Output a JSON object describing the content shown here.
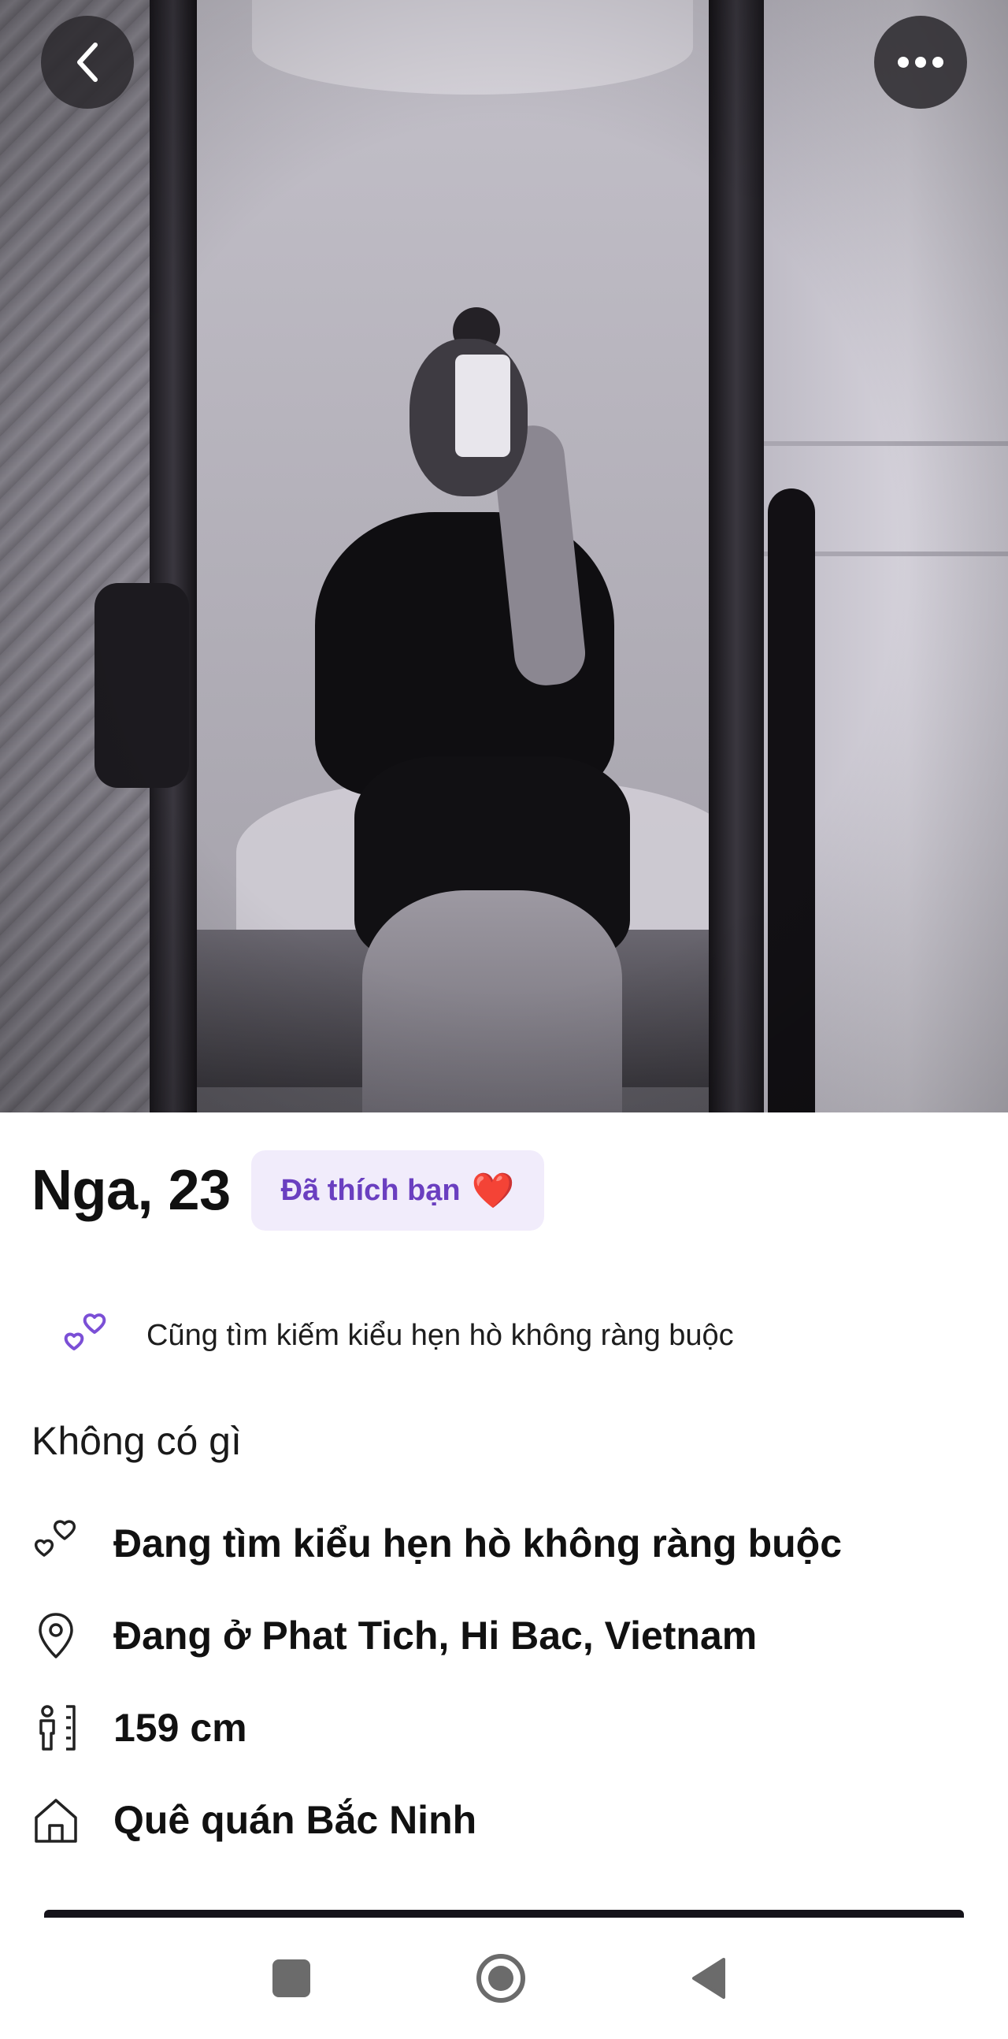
{
  "profile": {
    "name_age": "Nga, 23",
    "liked_badge": "Đã thích bạn",
    "liked_badge_emoji": "❤️",
    "also_looking": "Cũng tìm kiếm kiểu hẹn hò không ràng buộc",
    "bio": "Không có gì",
    "details": [
      {
        "icon": "hearts-icon",
        "text": "Đang tìm kiểu hẹn hò không ràng buộc"
      },
      {
        "icon": "location-pin-icon",
        "text": "Đang ở Phat Tich, Hi Bac, Vietnam"
      },
      {
        "icon": "height-icon",
        "text": "159 cm"
      },
      {
        "icon": "home-icon",
        "text": "Quê quán Bắc Ninh"
      }
    ]
  },
  "colors": {
    "accent_purple": "#6a3fc0",
    "badge_bg": "#f1ecfb",
    "overlay_button": "#2d2b30"
  },
  "icons": {
    "back": "chevron-left-icon",
    "more": "more-horizontal-icon",
    "nav_recent": "square-icon",
    "nav_home": "circle-icon",
    "nav_back": "triangle-back-icon"
  }
}
